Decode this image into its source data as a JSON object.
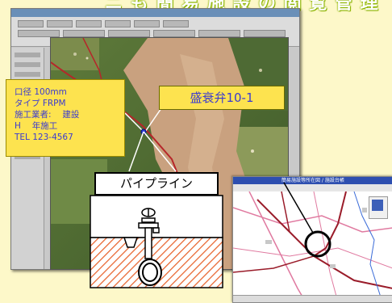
{
  "header": {
    "partial_title": "ニ も 簡 易 施 設 の 閲 覧 管 理"
  },
  "info_box": {
    "lines": [
      "口径 100mm",
      "タイプ FRPM",
      "施工業者:　 建設",
      "H　 年施工",
      "TEL 123-4567"
    ]
  },
  "valve_label": "盛衰弁10-1",
  "pipe_label": "パイプライン",
  "map_window": {
    "caption": "簡易施設等所在図 / 施設台帳"
  },
  "colors": {
    "background": "#fdf8c9",
    "callout_fill": "#fde34f",
    "callout_text": "#3b3bd0",
    "soil_hatch": "#e8632c",
    "accent_header": "#8cb400"
  },
  "icons": [
    "valve-handle-icon",
    "pipe-icon",
    "target-circle-icon"
  ]
}
